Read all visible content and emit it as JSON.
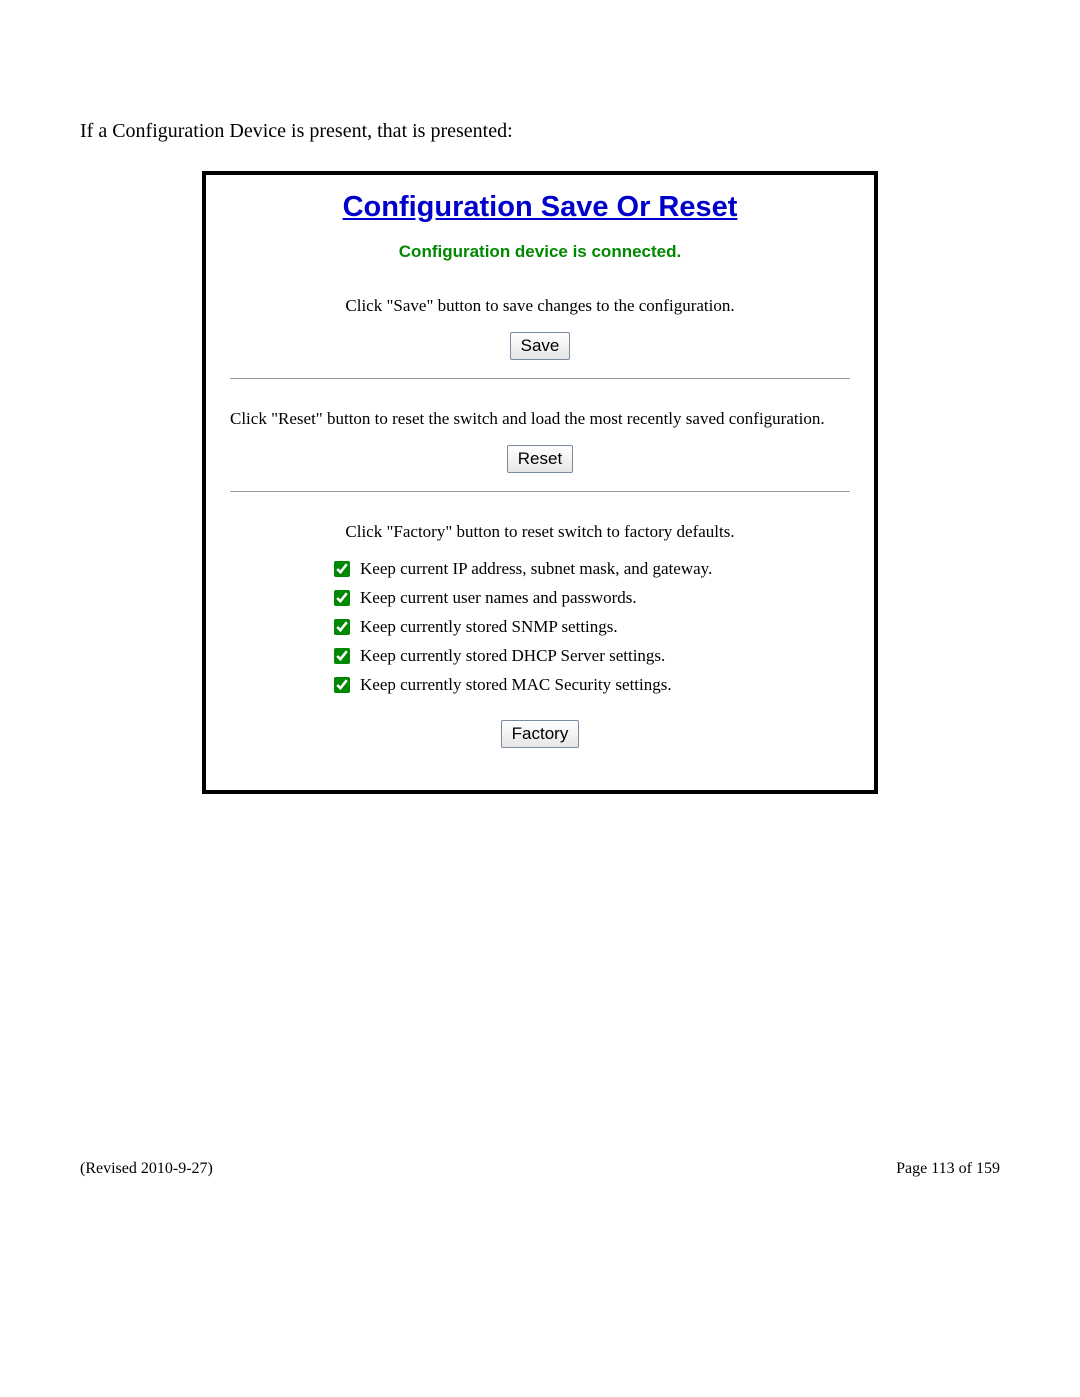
{
  "intro": "If a Configuration Device is present, that is presented:",
  "panel": {
    "title": "Configuration Save Or Reset",
    "status": "Configuration device is connected.",
    "save_instr": "Click \"Save\" button to save changes to the configuration.",
    "save_label": "Save",
    "reset_instr": "Click \"Reset\" button to reset the switch and load the most recently saved configuration.",
    "reset_label": "Reset",
    "factory_instr": "Click \"Factory\" button to reset switch to factory defaults.",
    "factory_label": "Factory",
    "checks": [
      "Keep current IP address, subnet mask, and gateway.",
      "Keep current user names and passwords.",
      "Keep currently stored SNMP settings.",
      "Keep currently stored DHCP Server settings.",
      "Keep currently stored MAC Security settings."
    ]
  },
  "footer": {
    "revised": "(Revised 2010-9-27)",
    "page": "Page 113 of 159"
  }
}
